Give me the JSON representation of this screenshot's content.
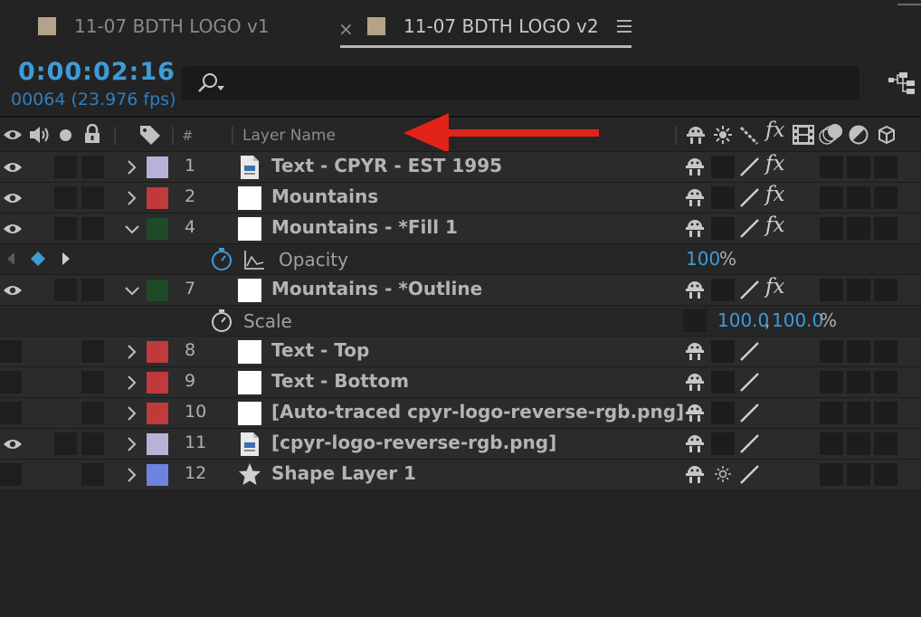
{
  "tabs": [
    {
      "label": "11-07 BDTH LOGO v1",
      "active": false
    },
    {
      "label": "11-07 BDTH LOGO v2",
      "active": true
    }
  ],
  "tab_close_glyph": "×",
  "timecode": "0:00:02:16",
  "frame_info": "00064 (23.976 fps)",
  "search": {
    "placeholder": "",
    "value": ""
  },
  "header": {
    "num_label": "#",
    "name_label": "Layer Name"
  },
  "colors": {
    "accent": "#3f9bd8",
    "label_lavender": "#b7b2d6",
    "label_red": "#c03a3c",
    "label_green": "#1e4a28",
    "label_blue": "#6e82e0",
    "arrow": "#e2231a"
  },
  "layers": [
    {
      "num": "1",
      "name": "Text - CPYR - EST 1995"
    },
    {
      "num": "2",
      "name": "Mountains"
    },
    {
      "num": "4",
      "name": "Mountains - *Fill 1"
    },
    {
      "num": "7",
      "name": "Mountains - *Outline"
    },
    {
      "num": "8",
      "name": "Text - Top"
    },
    {
      "num": "9",
      "name": "Text - Bottom"
    },
    {
      "num": "10",
      "name": "[Auto-traced cpyr-logo-reverse-rgb.png]"
    },
    {
      "num": "11",
      "name": "[cpyr-logo-reverse-rgb.png]"
    },
    {
      "num": "12",
      "name": "Shape Layer 1"
    }
  ],
  "properties": {
    "opacity": {
      "name": "Opacity",
      "value": "100",
      "unit": "%"
    },
    "scale": {
      "name": "Scale",
      "value_x": "100.0",
      "sep": ",",
      "value_y": "100.0",
      "unit": "%"
    }
  },
  "fx_label": "fx"
}
